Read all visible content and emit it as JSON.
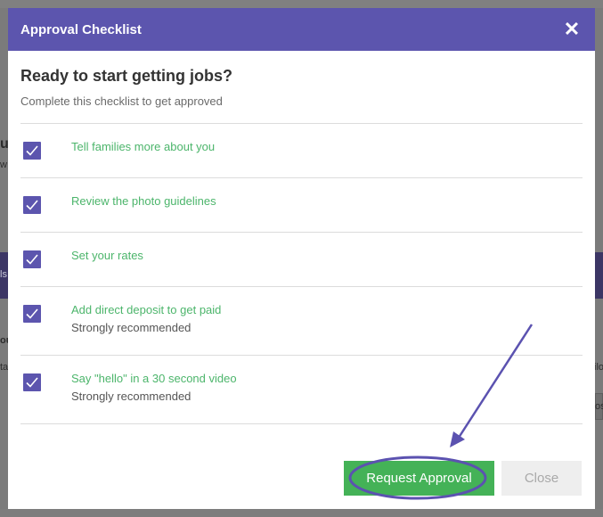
{
  "modal": {
    "title": "Approval Checklist",
    "close_icon": "✕",
    "heading": "Ready to start getting jobs?",
    "subheading": "Complete this checklist to get approved"
  },
  "checklist": [
    {
      "label": "Tell families more about you",
      "checked": true
    },
    {
      "label": "Review the photo guidelines",
      "checked": true
    },
    {
      "label": "Set your rates",
      "checked": true
    },
    {
      "label": "Add direct deposit to get paid",
      "note": "Strongly recommended",
      "checked": true
    },
    {
      "label": "Say \"hello\" in a 30 second video",
      "note": "Strongly recommended",
      "checked": true
    }
  ],
  "footer": {
    "primary_label": "Request Approval",
    "secondary_label": "Close"
  },
  "background": {
    "left_fragments": [
      "u",
      "w",
      "ls",
      "ou",
      "ta"
    ],
    "right_fragments": [
      "ilo",
      "os"
    ]
  },
  "colors": {
    "accent": "#5c55ae",
    "success": "#44b257",
    "item_text": "#4cb56b",
    "annotation": "#5b52b0"
  }
}
